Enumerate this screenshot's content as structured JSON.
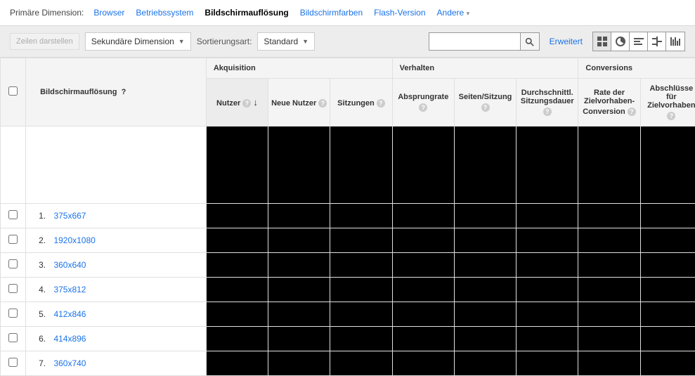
{
  "primary": {
    "label": "Primäre Dimension:",
    "tabs": [
      "Browser",
      "Betriebssystem",
      "Bildschirmauflösung",
      "Bildschirmfarben",
      "Flash-Version",
      "Andere"
    ],
    "active": "Bildschirmauflösung"
  },
  "toolbar": {
    "rows_btn": "Zeilen darstellen",
    "secondary_dim": "Sekundäre Dimension",
    "sort_label": "Sortierungsart:",
    "sort_value": "Standard",
    "search_placeholder": "",
    "advanced": "Erweitert"
  },
  "table": {
    "dim_header": "Bildschirmauflösung",
    "groups": [
      {
        "label": "Akquisition",
        "span": 3
      },
      {
        "label": "Verhalten",
        "span": 3
      },
      {
        "label": "Conversions",
        "span": 2
      }
    ],
    "cols": [
      "Nutzer",
      "Neue Nutzer",
      "Sitzungen",
      "Absprungrate",
      "Seiten/Sitzung",
      "Durchschnittl. Sitzungsdauer",
      "Rate der Zielvorhaben-Conversion",
      "Abschlüsse für Zielvorhaben"
    ],
    "sorted_col": 0,
    "rows": [
      {
        "i": "1.",
        "v": "375x667"
      },
      {
        "i": "2.",
        "v": "1920x1080"
      },
      {
        "i": "3.",
        "v": "360x640"
      },
      {
        "i": "4.",
        "v": "375x812"
      },
      {
        "i": "5.",
        "v": "412x846"
      },
      {
        "i": "6.",
        "v": "414x896"
      },
      {
        "i": "7.",
        "v": "360x740"
      }
    ]
  }
}
